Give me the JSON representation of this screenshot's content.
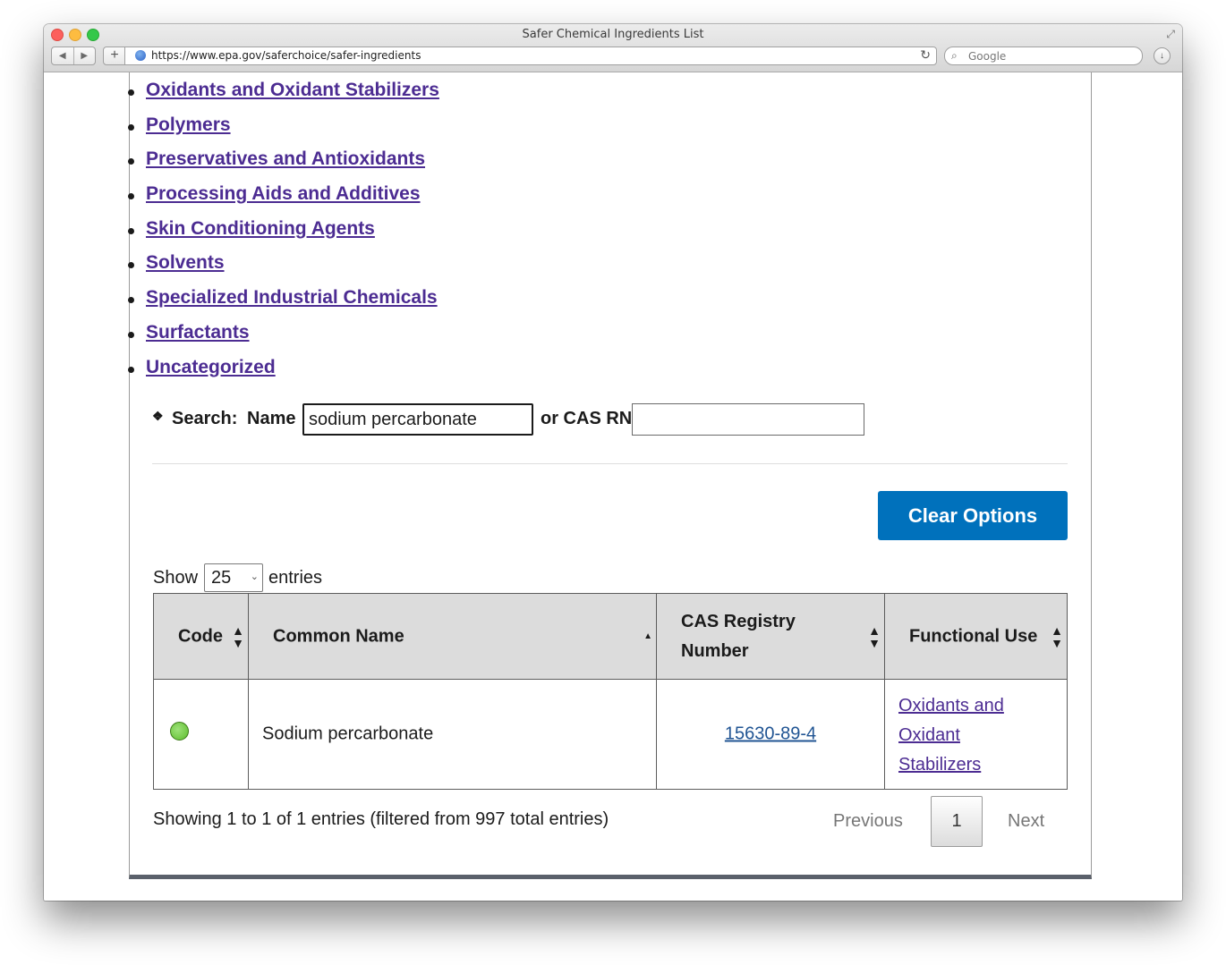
{
  "window": {
    "title": "Safer Chemical Ingredients List",
    "url": "https://www.epa.gov/saferchoice/safer-ingredients",
    "search_placeholder": "Google",
    "icons": {
      "back": "back-arrow-icon",
      "forward": "forward-arrow-icon",
      "add": "plus-icon",
      "reload": "reload-icon",
      "search": "magnifier-icon",
      "download": "download-icon",
      "fullscreen": "fullscreen-icon"
    }
  },
  "categories": [
    "Oxidants and Oxidant Stabilizers",
    "Polymers",
    "Preservatives and Antioxidants",
    "Processing Aids and Additives",
    "Skin Conditioning Agents",
    "Solvents",
    "Specialized Industrial Chemicals",
    "Surfactants",
    "Uncategorized"
  ],
  "search": {
    "label": "Search:",
    "name_label": "Name",
    "name_value": "sodium percarbonate",
    "cas_label": "or CAS RN",
    "cas_value": ""
  },
  "clear_button": "Clear Options",
  "length_menu": {
    "show": "Show",
    "value": "25",
    "entries": "entries"
  },
  "table": {
    "headers": [
      "Code",
      "Common Name",
      "CAS Registry Number",
      "Functional Use"
    ],
    "rows": [
      {
        "code_color": "#6cc83a",
        "common_name": "Sodium percarbonate",
        "cas": "15630-89-4",
        "functional_use": "Oxidants and Oxidant Stabilizers"
      }
    ]
  },
  "info": "Showing 1 to 1 of 1 entries (filtered from 997 total entries)",
  "pagination": {
    "previous": "Previous",
    "current_page": "1",
    "next": "Next"
  },
  "colors": {
    "link_visited": "#4c2c92",
    "link": "#205493",
    "primary_button": "#0071bc"
  }
}
